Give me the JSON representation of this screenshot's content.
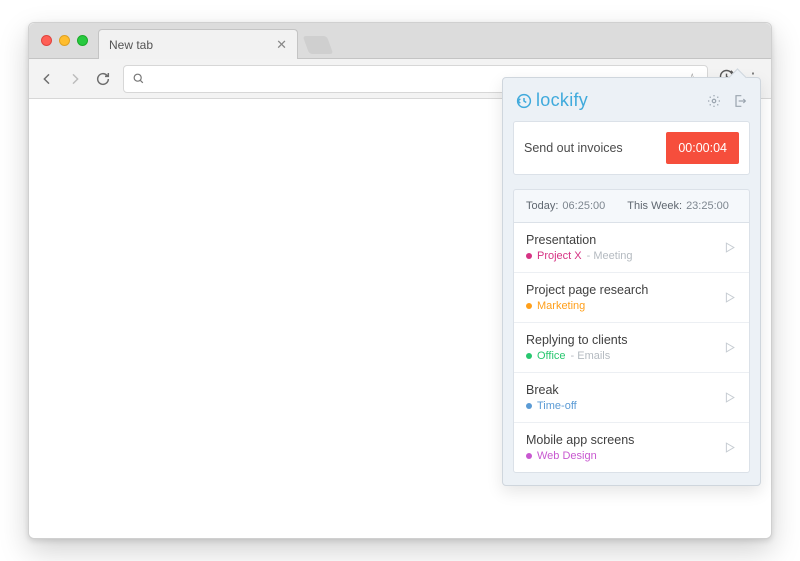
{
  "browser": {
    "tab_title": "New tab",
    "url": ""
  },
  "popup": {
    "brand": "lockify",
    "tracker": {
      "description": "Send out invoices",
      "elapsed": "00:00:04",
      "timer_color": "#f64e3c"
    },
    "stats": {
      "today_label": "Today:",
      "today_value": "06:25:00",
      "week_label": "This Week:",
      "week_value": "23:25:00"
    },
    "entries": [
      {
        "title": "Presentation",
        "project": "Project X",
        "project_color": "#d63384",
        "tag": "Meeting"
      },
      {
        "title": "Project page research",
        "project": "Marketing",
        "project_color": "#ff9f1a",
        "tag": ""
      },
      {
        "title": "Replying to clients",
        "project": "Office",
        "project_color": "#28c76f",
        "tag": "Emails"
      },
      {
        "title": "Break",
        "project": "Time-off",
        "project_color": "#5b9bd5",
        "tag": ""
      },
      {
        "title": "Mobile app screens",
        "project": "Web Design",
        "project_color": "#c858d0",
        "tag": ""
      }
    ]
  }
}
